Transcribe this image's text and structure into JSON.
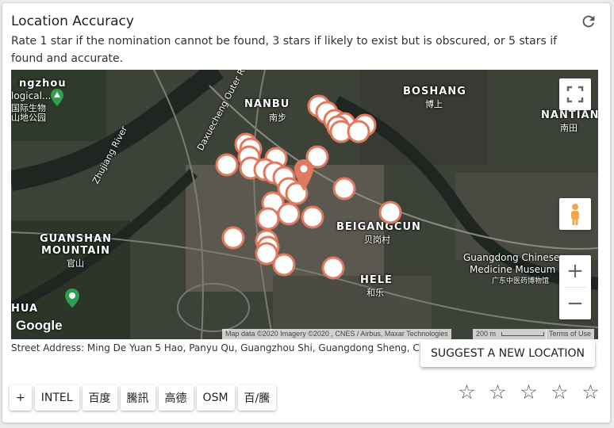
{
  "card": {
    "title": "Location Accuracy",
    "description": "Rate 1 star if the nomination cannot be found, 3 stars if likely to exist but is obscured, or 5 stars if found and accurate."
  },
  "map": {
    "labels": {
      "nanbu": "NANBU",
      "nanbu_cn": "南步",
      "boshang": "BOSHANG",
      "boshang_cn": "博上",
      "nantian": "NANTIAN",
      "nantian_cn": "南田",
      "guanshan1": "GUANSHAN",
      "guanshan2": "MOUNTAIN",
      "guanshan_cn": "官山",
      "beigangcun": "BEIGANGCUN",
      "beigangcun_cn": "贝岗村",
      "hele": "HELE",
      "hele_cn": "和乐",
      "hua": "HUA",
      "zhujiang": "Zhujiang River",
      "daxuecheng": "Daxuecheng Outer Ring",
      "museum1": "Guangdong Chinese",
      "museum2": "Medicine Museum",
      "museum_cn": "广东中医药博物馆",
      "park1": "ngzhou",
      "park2": "logical...",
      "park_cn1": "国际生物",
      "park_cn2": "山地公园"
    },
    "google_logo": "Google",
    "attribution": "Map data ©2020 Imagery ©2020 , CNES / Airbus, Maxar Technologies",
    "scale": "200 m",
    "terms": "Terms of Use",
    "zoom_in": "+",
    "zoom_out": "−",
    "icons": [
      "fullscreen-icon",
      "pegman-icon",
      "location-pin-icon",
      "refresh-icon"
    ],
    "marker_color": "#e07a5f"
  },
  "address": "Street Address: Ming De Yuan 5 Hao, Panyu Qu, Guangzhou Shi, Guangdong Sheng, China",
  "suggest_label": "SUGGEST A NEW LOCATION",
  "source_buttons": [
    "+",
    "INTEL",
    "百度",
    "騰訊",
    "高德",
    "OSM",
    "百/騰"
  ],
  "stars": [
    "☆",
    "☆",
    "☆",
    "☆",
    "☆"
  ],
  "rating": 0
}
